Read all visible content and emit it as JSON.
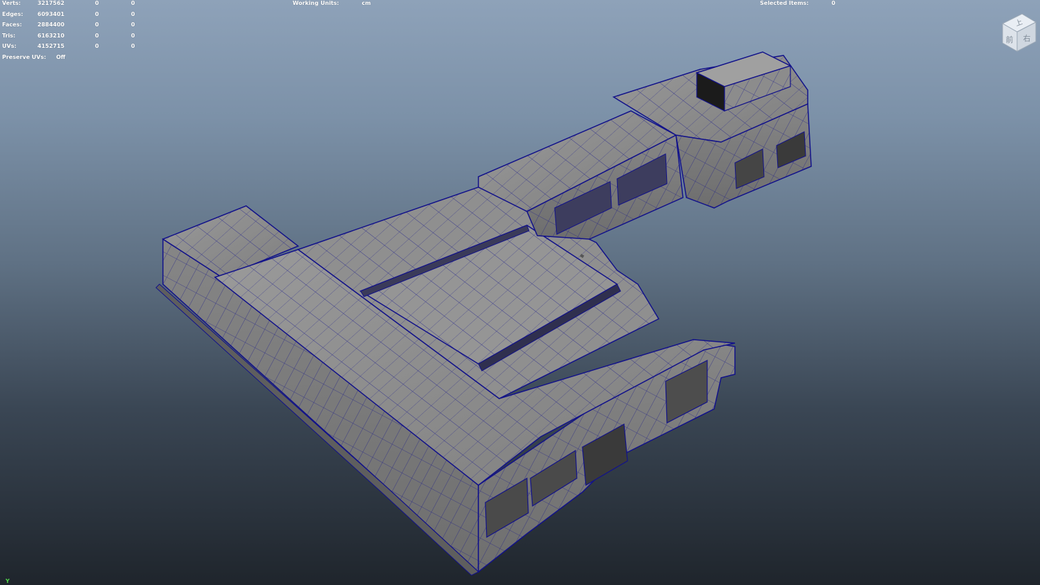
{
  "hud": {
    "stats": [
      {
        "label": "Verts:",
        "total": "3217562",
        "selected": "0",
        "components": "0"
      },
      {
        "label": "Edges:",
        "total": "6093401",
        "selected": "0",
        "components": "0"
      },
      {
        "label": "Faces:",
        "total": "2884400",
        "selected": "0",
        "components": "0"
      },
      {
        "label": "Tris:",
        "total": "6163210",
        "selected": "0",
        "components": "0"
      },
      {
        "label": "UVs:",
        "total": "4152715",
        "selected": "0",
        "components": "0"
      }
    ],
    "preserve_uvs": {
      "label": "Preserve UVs:",
      "value": "Off"
    },
    "working_units": {
      "label": "Working Units:",
      "value": "cm"
    },
    "selected_items": {
      "label": "Selected Items:",
      "value": "0"
    }
  },
  "viewcube": {
    "faces": [
      "上",
      "前",
      "右"
    ],
    "icon": "viewcube-icon"
  },
  "axis_indicator": {
    "label": "Y",
    "color": "#52d64a"
  },
  "colors": {
    "background_top": "#8ea2b9",
    "background_bottom": "#1f252c",
    "mesh_fill": "#8a8a8a",
    "wireframe": "#12128a"
  }
}
